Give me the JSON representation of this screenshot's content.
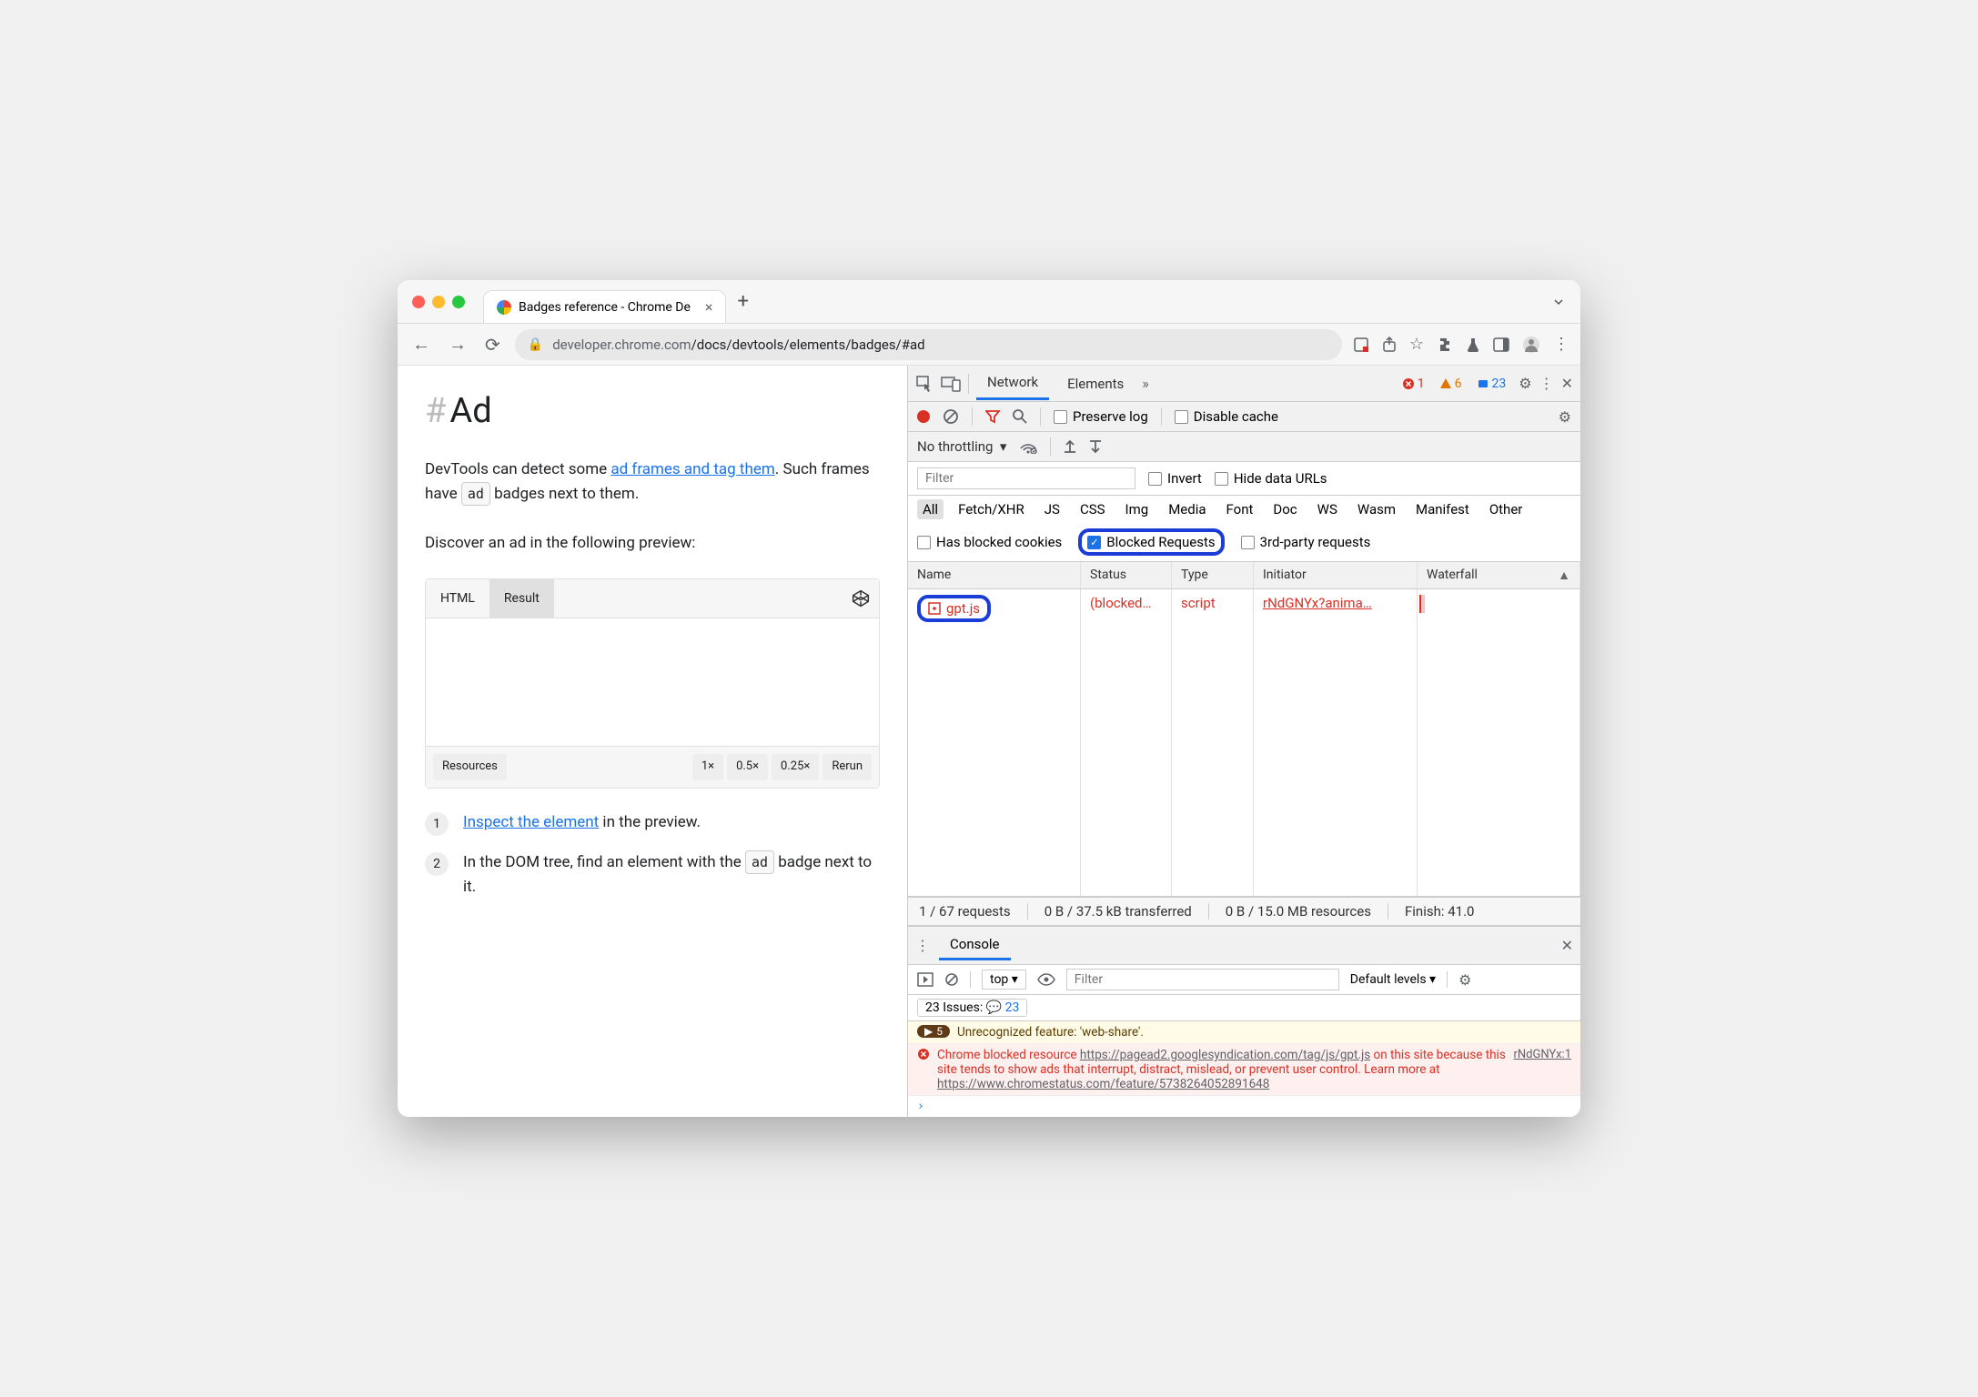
{
  "browser": {
    "tab_title": "Badges reference - Chrome De",
    "url_host": "developer.chrome.com",
    "url_path": "/docs/devtools/elements/badges/#ad"
  },
  "page": {
    "heading": "Ad",
    "intro_1": "DevTools can detect some ",
    "intro_link": "ad frames and tag them",
    "intro_2": ". Such frames have ",
    "ad_badge": "ad",
    "intro_3": " badges next to them.",
    "discover": "Discover an ad in the following preview:",
    "tab_html": "HTML",
    "tab_result": "Result",
    "foot_resources": "Resources",
    "foot_1x": "1×",
    "foot_05x": "0.5×",
    "foot_025x": "0.25×",
    "foot_rerun": "Rerun",
    "step1_link": "Inspect the element",
    "step1_rest": " in the preview.",
    "step2_a": "In the DOM tree, find an element with the ",
    "step2_b": " badge next to it."
  },
  "devtools": {
    "tab_network": "Network",
    "tab_elements": "Elements",
    "err_count": "1",
    "warn_count": "6",
    "info_count": "23",
    "preserve_log": "Preserve log",
    "disable_cache": "Disable cache",
    "no_throttling": "No throttling",
    "filter_placeholder": "Filter",
    "invert": "Invert",
    "hide_data_urls": "Hide data URLs",
    "filters": {
      "all": "All",
      "fetch": "Fetch/XHR",
      "js": "JS",
      "css": "CSS",
      "img": "Img",
      "media": "Media",
      "font": "Font",
      "doc": "Doc",
      "ws": "WS",
      "wasm": "Wasm",
      "manifest": "Manifest",
      "other": "Other"
    },
    "has_blocked_cookies": "Has blocked cookies",
    "blocked_requests": "Blocked Requests",
    "third_party": "3rd-party requests",
    "cols": {
      "name": "Name",
      "status": "Status",
      "type": "Type",
      "initiator": "Initiator",
      "waterfall": "Waterfall"
    },
    "row": {
      "name": "gpt.js",
      "status": "(blocked…",
      "type": "script",
      "initiator": "rNdGNYx?anima…"
    },
    "summary_requests": "1 / 67 requests",
    "summary_transferred": "0 B / 37.5 kB transferred",
    "summary_resources": "0 B / 15.0 MB resources",
    "summary_finish": "Finish: 41.0"
  },
  "console": {
    "title": "Console",
    "top": "top",
    "filter_placeholder": "Filter",
    "default_levels": "Default levels",
    "issues_label": "23 Issues:",
    "issues_count": "23",
    "warn_count": "5",
    "warn_msg": "Unrecognized feature: 'web-share'.",
    "err_pre": "Chrome blocked resource ",
    "err_url1": "https://pagead2.googlesyndication.com/tag/js/gpt.js",
    "err_txt": " on this site because this site tends to show ads that interrupt, distract, mislead, or prevent user control. Learn more at ",
    "err_url2": "https://www.chromestatus.com/feature/5738264052891648",
    "err_src": "rNdGNYx:1"
  }
}
